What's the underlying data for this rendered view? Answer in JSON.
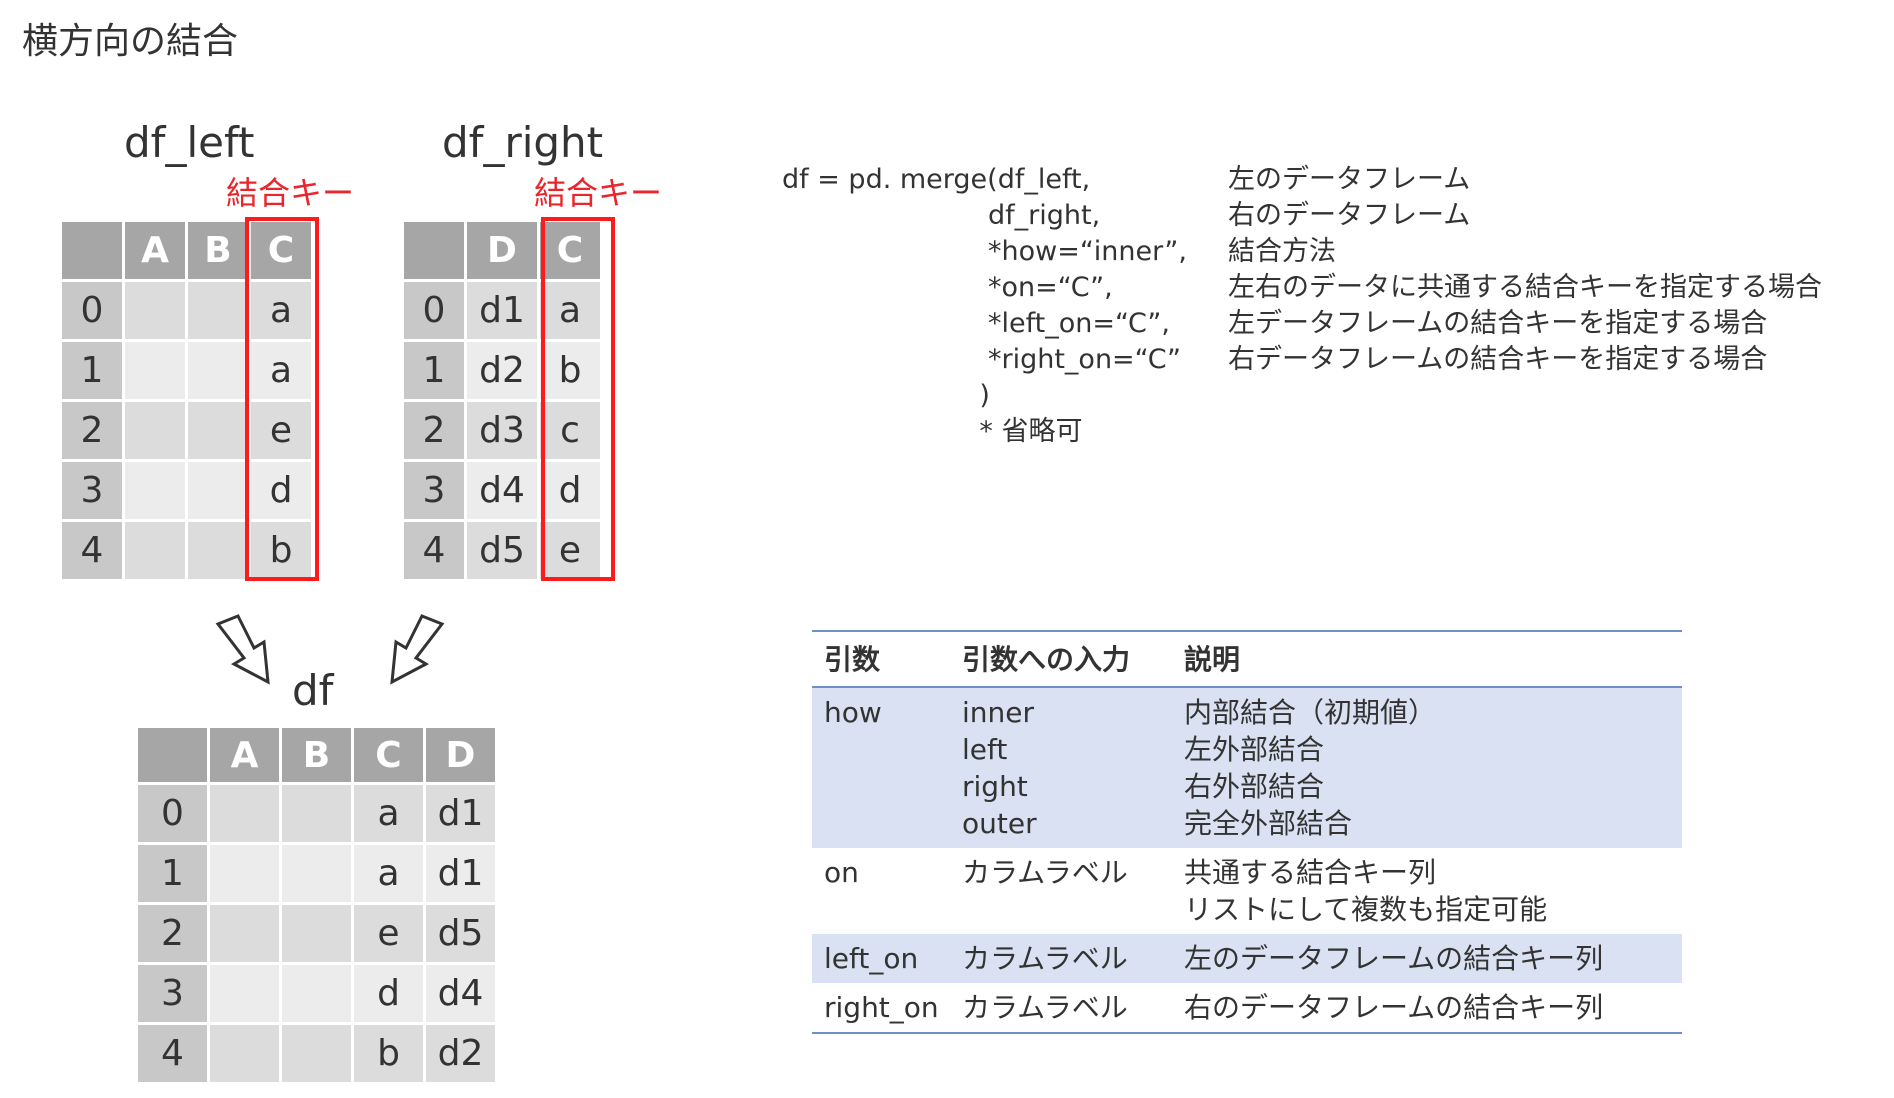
{
  "page_title": "横方向の結合",
  "left_table": {
    "title": "df_left",
    "key_label": "結合キー",
    "columns": [
      "",
      "A",
      "B",
      "C"
    ],
    "rows": [
      [
        "0",
        "",
        "",
        "a"
      ],
      [
        "1",
        "",
        "",
        "a"
      ],
      [
        "2",
        "",
        "",
        "e"
      ],
      [
        "3",
        "",
        "",
        "d"
      ],
      [
        "4",
        "",
        "",
        "b"
      ]
    ]
  },
  "right_table": {
    "title": "df_right",
    "key_label": "結合キー",
    "columns": [
      "",
      "D",
      "C"
    ],
    "rows": [
      [
        "0",
        "d1",
        "a"
      ],
      [
        "1",
        "d2",
        "b"
      ],
      [
        "2",
        "d3",
        "c"
      ],
      [
        "3",
        "d4",
        "d"
      ],
      [
        "4",
        "d5",
        "e"
      ]
    ]
  },
  "result_table": {
    "title": "df",
    "columns": [
      "",
      "A",
      "B",
      "C",
      "D"
    ],
    "rows": [
      [
        "0",
        "",
        "",
        "a",
        "d1"
      ],
      [
        "1",
        "",
        "",
        "a",
        "d1"
      ],
      [
        "2",
        "",
        "",
        "e",
        "d5"
      ],
      [
        "3",
        "",
        "",
        "d",
        "d4"
      ],
      [
        "4",
        "",
        "",
        "b",
        "d2"
      ]
    ]
  },
  "code": {
    "lines": [
      {
        "code": "df = pd. merge(df_left,",
        "comment": "左のデータフレーム"
      },
      {
        "code": "                        df_right,",
        "comment": "右のデータフレーム"
      },
      {
        "code": "                        *how=“inner”,",
        "comment": "結合方法"
      },
      {
        "code": "                        *on=“C”,",
        "comment": "左右のデータに共通する結合キーを指定する場合"
      },
      {
        "code": "                        *left_on=“C”,",
        "comment": "左データフレームの結合キーを指定する場合"
      },
      {
        "code": "                        *right_on=“C”",
        "comment": "右データフレームの結合キーを指定する場合"
      },
      {
        "code": "                       )",
        "comment": ""
      },
      {
        "code": "                       * 省略可",
        "comment": ""
      }
    ]
  },
  "arg_table": {
    "headers": [
      "引数",
      "引数への入力",
      "説明"
    ],
    "rows": [
      {
        "arg": "how",
        "inputs": [
          "inner",
          "left",
          "right",
          "outer"
        ],
        "desc": [
          "内部結合（初期値）",
          "左外部結合",
          "右外部結合",
          "完全外部結合"
        ],
        "shaded": true
      },
      {
        "arg": "on",
        "inputs": [
          "カラムラベル"
        ],
        "desc": [
          "共通する結合キー列",
          "リストにして複数も指定可能"
        ],
        "shaded": false
      },
      {
        "arg": "left_on",
        "inputs": [
          "カラムラベル"
        ],
        "desc": [
          "左のデータフレームの結合キー列"
        ],
        "shaded": true
      },
      {
        "arg": "right_on",
        "inputs": [
          "カラムラベル"
        ],
        "desc": [
          "右のデータフレームの結合キー列"
        ],
        "shaded": false
      }
    ]
  },
  "colors": {
    "key_highlight": "#ff1b1b",
    "header_gray": "#a6a6a6",
    "table_rule": "#6f8fc5",
    "row_shade": "#d9e1f2"
  }
}
